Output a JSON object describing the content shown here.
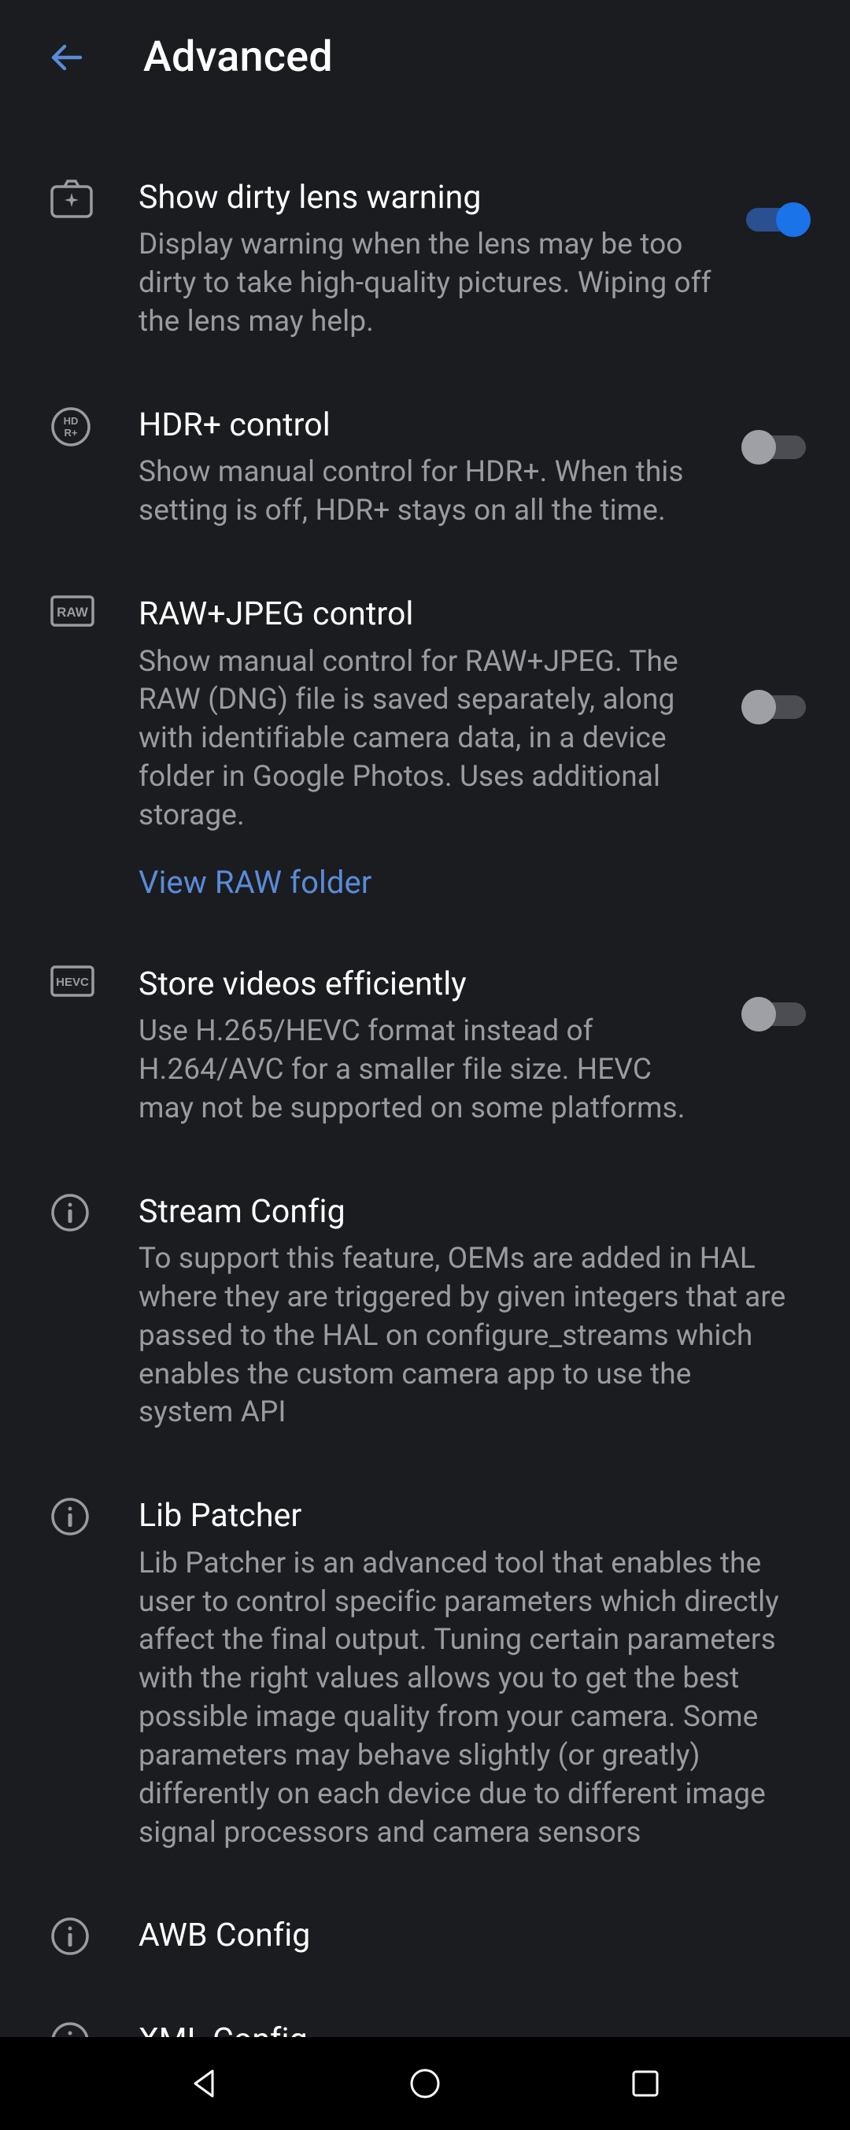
{
  "header": {
    "title": "Advanced"
  },
  "items": {
    "dirty_lens": {
      "title": "Show dirty lens warning",
      "desc": "Display warning when the lens may be too dirty to take high-quality pictures. Wiping off the lens may help.",
      "on": true
    },
    "hdr_plus": {
      "title": "HDR+ control",
      "desc": "Show manual control for HDR+. When this setting is off, HDR+ stays on all the time.",
      "on": false
    },
    "raw_jpeg": {
      "title": "RAW+JPEG control",
      "desc": "Show manual control for RAW+JPEG. The RAW (DNG) file is saved separately, along with identifiable camera data, in a device folder in Google Photos. Uses additional storage.",
      "link": "View RAW folder",
      "on": false
    },
    "hevc": {
      "title": "Store videos efficiently",
      "desc": "Use H.265/HEVC format instead of H.264/AVC for a smaller file size. HEVC may not be supported on some platforms.",
      "on": false
    },
    "stream_config": {
      "title": "Stream Config",
      "desc": "To support this feature, OEMs are added in HAL where they are triggered by given integers that are passed to the HAL on configure_streams which enables the custom camera app to use the system API"
    },
    "lib_patcher": {
      "title": "Lib Patcher",
      "desc": "Lib Patcher is an advanced tool that enables the user to control specific parameters which directly affect the final output. Tuning certain parameters with the right values allows you to get the best possible image quality from your camera. Some parameters may behave slightly (or greatly) differently on each device due to different image signal processors and camera sensors"
    },
    "awb_config": {
      "title": "AWB Config"
    },
    "xml_config": {
      "title": "XML Config"
    }
  }
}
